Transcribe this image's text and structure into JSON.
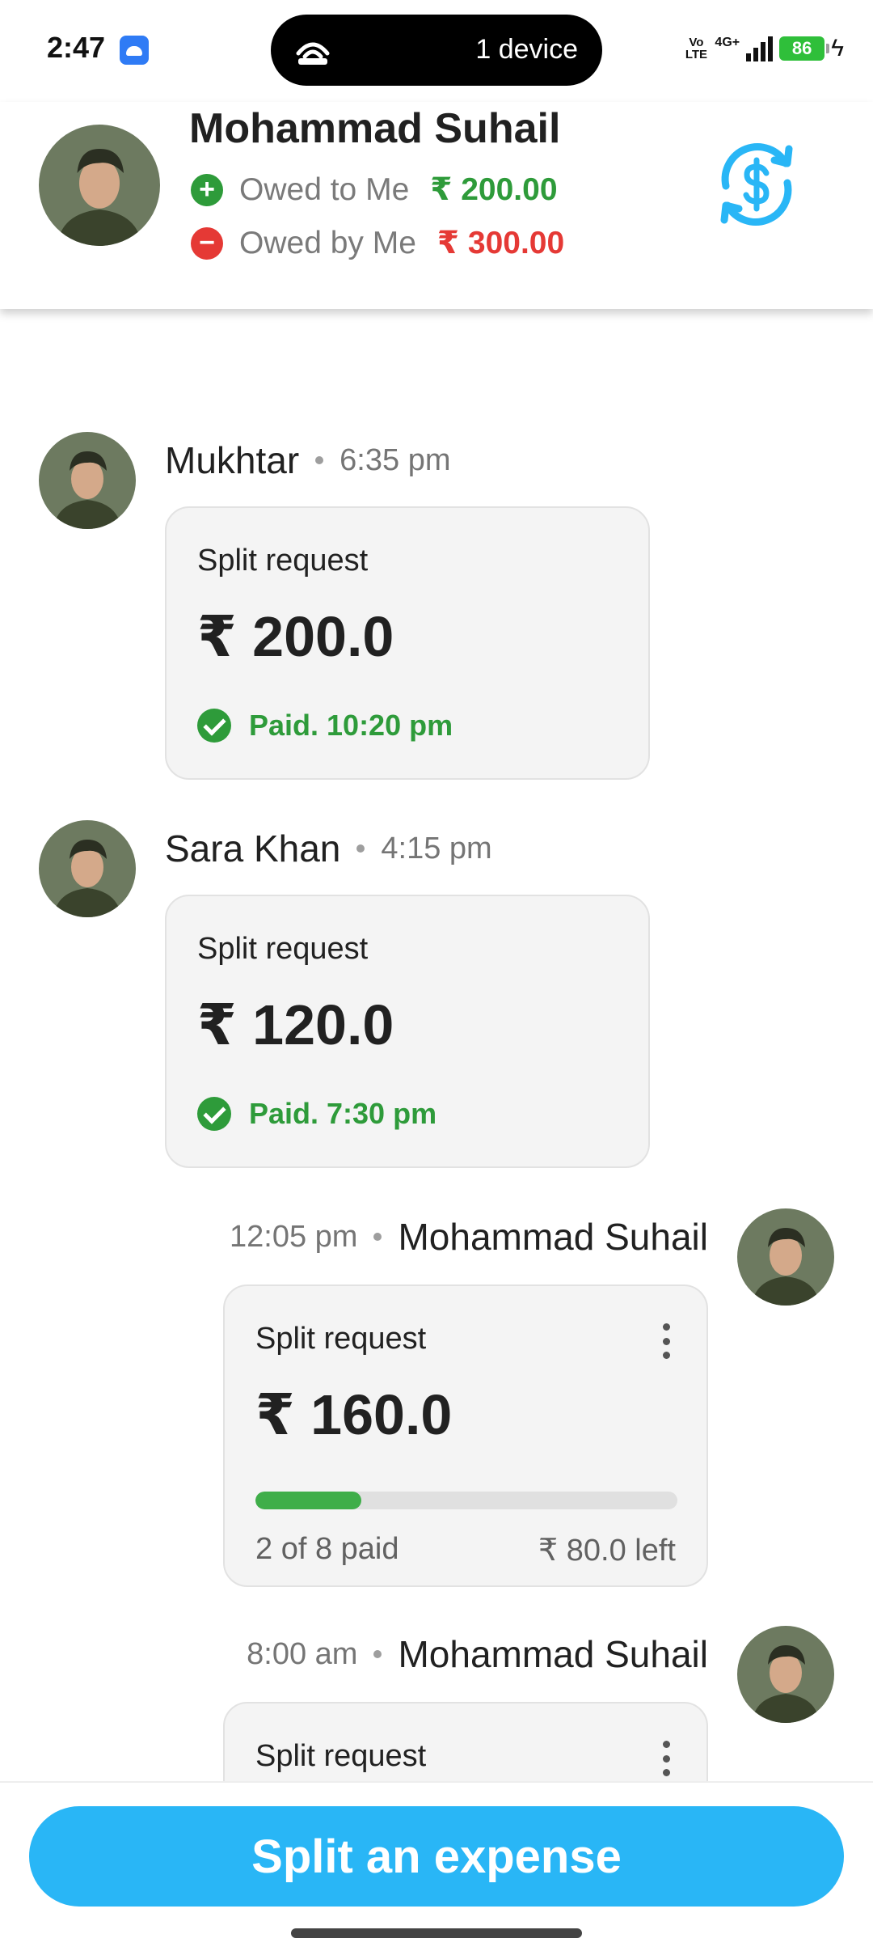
{
  "status_bar": {
    "time": "2:47",
    "pill_text": "1 device",
    "volte": "Vo LTE",
    "network": "4G+",
    "battery": "86"
  },
  "header": {
    "name": "Mohammad Suhail",
    "owed_to_me": {
      "label": "Owed to Me",
      "amount": "₹ 200.00",
      "color": "#2e9b3a"
    },
    "owed_by_me": {
      "label": "Owed by Me",
      "amount": "₹ 300.00",
      "color": "#e53935"
    },
    "action_icon": "currency-exchange-icon",
    "accent_color": "#29b6f6"
  },
  "messages": [
    {
      "sender": "Mukhtar",
      "time": "6:35 pm",
      "card": {
        "title": "Split request",
        "amount": "₹ 200.0",
        "status": "Paid. 10:20 pm"
      }
    },
    {
      "sender": "Sara Khan",
      "time": "4:15 pm",
      "card": {
        "title": "Split request",
        "amount": "₹ 120.0",
        "status": "Paid. 7:30 pm"
      }
    },
    {
      "sender": "Mohammad Suhail",
      "time": "12:05 pm",
      "card": {
        "title": "Split request",
        "amount": "₹ 160.0",
        "paid_fraction": 0.25,
        "progress_text": "2 of 8 paid",
        "left_text": "₹ 80.0 left"
      }
    },
    {
      "sender": "Mohammad Suhail",
      "time": "8:00 am",
      "card": {
        "title": "Split request"
      }
    }
  ],
  "primary_action": {
    "label": "Split an expense",
    "color": "#29b6f6"
  }
}
